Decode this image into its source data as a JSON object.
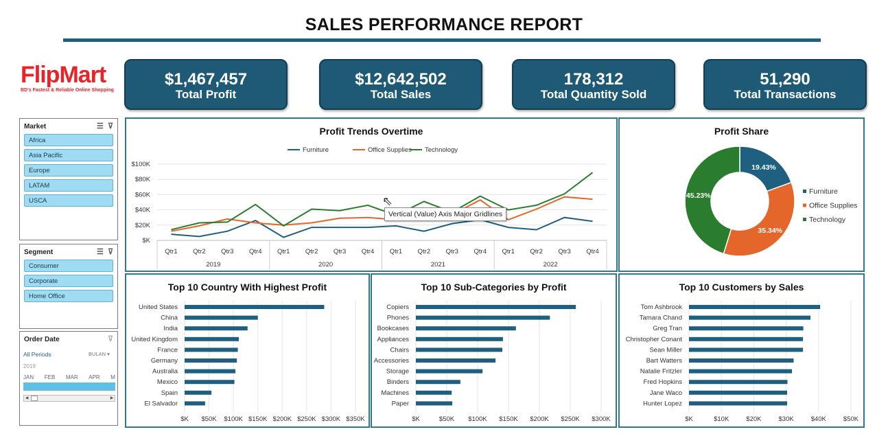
{
  "header": {
    "title": "SALES PERFORMANCE REPORT"
  },
  "logo": {
    "name_a": "Flip",
    "name_b": "Mart",
    "tagline": "BD's Fastest & Reliable Online Shopping"
  },
  "kpis": [
    {
      "value": "$1,467,457",
      "label": "Total Profit"
    },
    {
      "value": "$12,642,502",
      "label": "Total Sales"
    },
    {
      "value": "178,312",
      "label": "Total Quantity Sold"
    },
    {
      "value": "51,290",
      "label": "Total Transactions"
    }
  ],
  "slicers": {
    "market": {
      "title": "Market",
      "items": [
        "Africa",
        "Asia Pacific",
        "Europe",
        "LATAM",
        "USCA"
      ]
    },
    "segment": {
      "title": "Segment",
      "items": [
        "Consumer",
        "Corporate",
        "Home Office"
      ]
    },
    "order_date": {
      "title": "Order Date",
      "period": "All Periods",
      "unit": "BULAN",
      "year": "2019",
      "months": [
        "JAN",
        "FEB",
        "MAR",
        "APR",
        "M"
      ]
    }
  },
  "tooltip": {
    "text": "Vertical (Value) Axis Major Gridlines"
  },
  "colors": {
    "furniture": "#1f5f7f",
    "office_supplies": "#e4662b",
    "technology": "#2a7d2e",
    "accent": "#1e5a76",
    "panel_border": "#2a7a90"
  },
  "chart_data": [
    {
      "type": "line",
      "title": "Profit Trends Overtime",
      "categories": [
        "Qtr1",
        "Qtr2",
        "Qtr3",
        "Qtr4",
        "Qtr1",
        "Qtr2",
        "Qtr3",
        "Qtr4",
        "Qtr1",
        "Qtr2",
        "Qtr3",
        "Qtr4",
        "Qtr1",
        "Qtr2",
        "Qtr3",
        "Qtr4"
      ],
      "groups": [
        "2019",
        "2020",
        "2021",
        "2022"
      ],
      "yticks": [
        "$K",
        "$20K",
        "$40K",
        "$60K",
        "$80K",
        "$100K"
      ],
      "ylim": [
        0,
        100000
      ],
      "legend_position": "top",
      "series": [
        {
          "name": "Furniture",
          "values": [
            8000,
            5000,
            12000,
            26000,
            4000,
            17000,
            17000,
            17000,
            19000,
            12000,
            22000,
            27000,
            17000,
            14000,
            30000,
            25000
          ]
        },
        {
          "name": "Office Supplies",
          "values": [
            12000,
            19000,
            28000,
            23000,
            20000,
            23000,
            29000,
            30000,
            27000,
            28000,
            34000,
            53000,
            27000,
            41000,
            57000,
            54000
          ]
        },
        {
          "name": "Technology",
          "values": [
            14000,
            23000,
            24000,
            47000,
            19000,
            41000,
            39000,
            46000,
            33000,
            51000,
            37000,
            58000,
            40000,
            46000,
            61000,
            89000
          ]
        }
      ]
    },
    {
      "type": "pie",
      "title": "Profit Share",
      "labels": [
        "Furniture",
        "Office Supplies",
        "Technology"
      ],
      "values": [
        19.43,
        35.34,
        45.23
      ],
      "data_labels": [
        "19.43%",
        "35.34%",
        "45.23%"
      ],
      "legend_position": "right"
    },
    {
      "type": "bar",
      "title": "Top 10 Country With Highest Profit",
      "categories": [
        "United States",
        "China",
        "India",
        "United Kingdom",
        "France",
        "Germany",
        "Australia",
        "Mexico",
        "Spain",
        "El Salvador"
      ],
      "values": [
        286000,
        150000,
        129000,
        111000,
        109000,
        107000,
        104000,
        102000,
        55000,
        42000
      ],
      "xticks": [
        "$K",
        "$50K",
        "$100K",
        "$150K",
        "$200K",
        "$250K",
        "$300K",
        "$350K"
      ],
      "xlim": [
        0,
        350000
      ]
    },
    {
      "type": "bar",
      "title": "Top 10 Sub-Categories by Profit",
      "categories": [
        "Copiers",
        "Phones",
        "Bookcases",
        "Appliances",
        "Chairs",
        "Accessories",
        "Storage",
        "Binders",
        "Machines",
        "Paper"
      ],
      "values": [
        259000,
        217000,
        162000,
        141000,
        140000,
        129000,
        108000,
        72000,
        58000,
        59000
      ],
      "xticks": [
        "$K",
        "$50K",
        "$100K",
        "$150K",
        "$200K",
        "$250K",
        "$300K"
      ],
      "xlim": [
        0,
        300000
      ]
    },
    {
      "type": "bar",
      "title": "Top 10 Customers by Sales",
      "categories": [
        "Tom Ashbrook",
        "Tamara Chand",
        "Greg Tran",
        "Christopher Conant",
        "Sean Miller",
        "Bart Watters",
        "Natalie Fritzler",
        "Fred Hopkins",
        "Jane Waco",
        "Hunter Lopez"
      ],
      "values": [
        40500,
        37500,
        35300,
        35200,
        35200,
        32300,
        31800,
        30400,
        30300,
        30300
      ],
      "xticks": [
        "$K",
        "$10K",
        "$20K",
        "$30K",
        "$40K",
        "$50K"
      ],
      "xlim": [
        0,
        50000
      ]
    }
  ]
}
